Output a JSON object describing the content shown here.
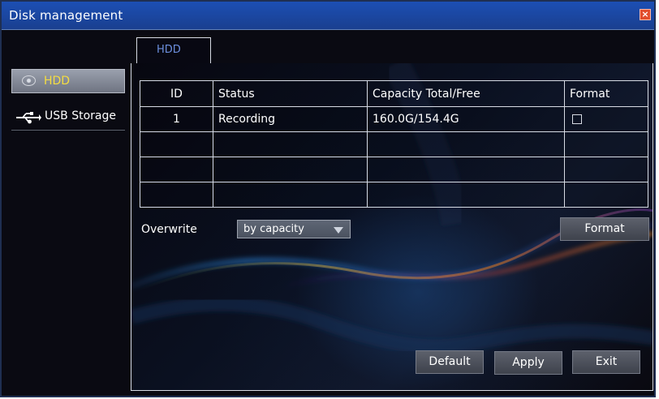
{
  "window": {
    "title": "Disk management",
    "close_symbol": "×"
  },
  "sidebar": {
    "items": [
      {
        "label": "HDD",
        "icon": "hard-disk-icon",
        "selected": true
      },
      {
        "label": "USB Storage",
        "icon": "usb-icon",
        "selected": false
      }
    ]
  },
  "tabs": [
    {
      "label": "HDD",
      "active": true
    }
  ],
  "table": {
    "columns": [
      "ID",
      "Status",
      "Capacity Total/Free",
      "Format"
    ],
    "rows": [
      {
        "id": "1",
        "status": "Recording",
        "capacity": "160.0G/154.4G",
        "format_checked": false
      },
      {
        "id": "",
        "status": "",
        "capacity": "",
        "format_checked": null
      },
      {
        "id": "",
        "status": "",
        "capacity": "",
        "format_checked": null
      },
      {
        "id": "",
        "status": "",
        "capacity": "",
        "format_checked": null
      }
    ]
  },
  "controls": {
    "overwrite_label": "Overwrite",
    "overwrite_value": "by capacity",
    "format_button": "Format",
    "default_button": "Default",
    "apply_button": "Apply",
    "exit_button": "Exit"
  },
  "colors": {
    "title_bar": "#1c4fb4",
    "selected_sidebar_text": "#f5dd41",
    "active_tab_text": "#6d8fdf",
    "panel_border": "#d7dbe4",
    "button": "#4a4e58"
  },
  "icons": {
    "close": "close-icon",
    "dropdown": "dropdown-arrow-icon",
    "checkbox": "checkbox-icon"
  }
}
